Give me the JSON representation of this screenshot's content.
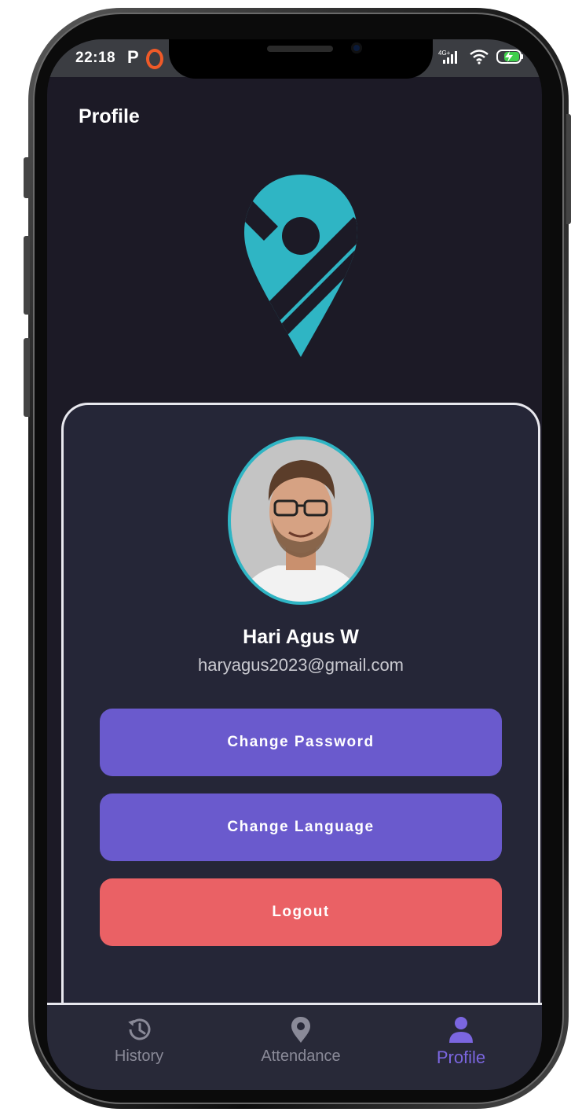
{
  "status_bar": {
    "time": "22:18",
    "carrier_letter": "P",
    "network": "4G+"
  },
  "header": {
    "title": "Profile"
  },
  "profile": {
    "name": "Hari Agus W",
    "email": "haryagus2023@gmail.com"
  },
  "actions": {
    "change_password": "Change Password",
    "change_language": "Change Language",
    "logout": "Logout"
  },
  "nav": {
    "items": [
      {
        "label": "History",
        "icon": "history-icon",
        "active": false
      },
      {
        "label": "Attendance",
        "icon": "location-pin-icon",
        "active": false
      },
      {
        "label": "Profile",
        "icon": "person-icon",
        "active": true
      }
    ]
  },
  "colors": {
    "background": "#1c1a26",
    "card": "#252637",
    "accent_teal": "#2fb5c4",
    "primary_button": "#6a5acd",
    "logout_button": "#ea6165",
    "nav_active": "#7b66e0",
    "nav_inactive": "#8a8a98"
  }
}
